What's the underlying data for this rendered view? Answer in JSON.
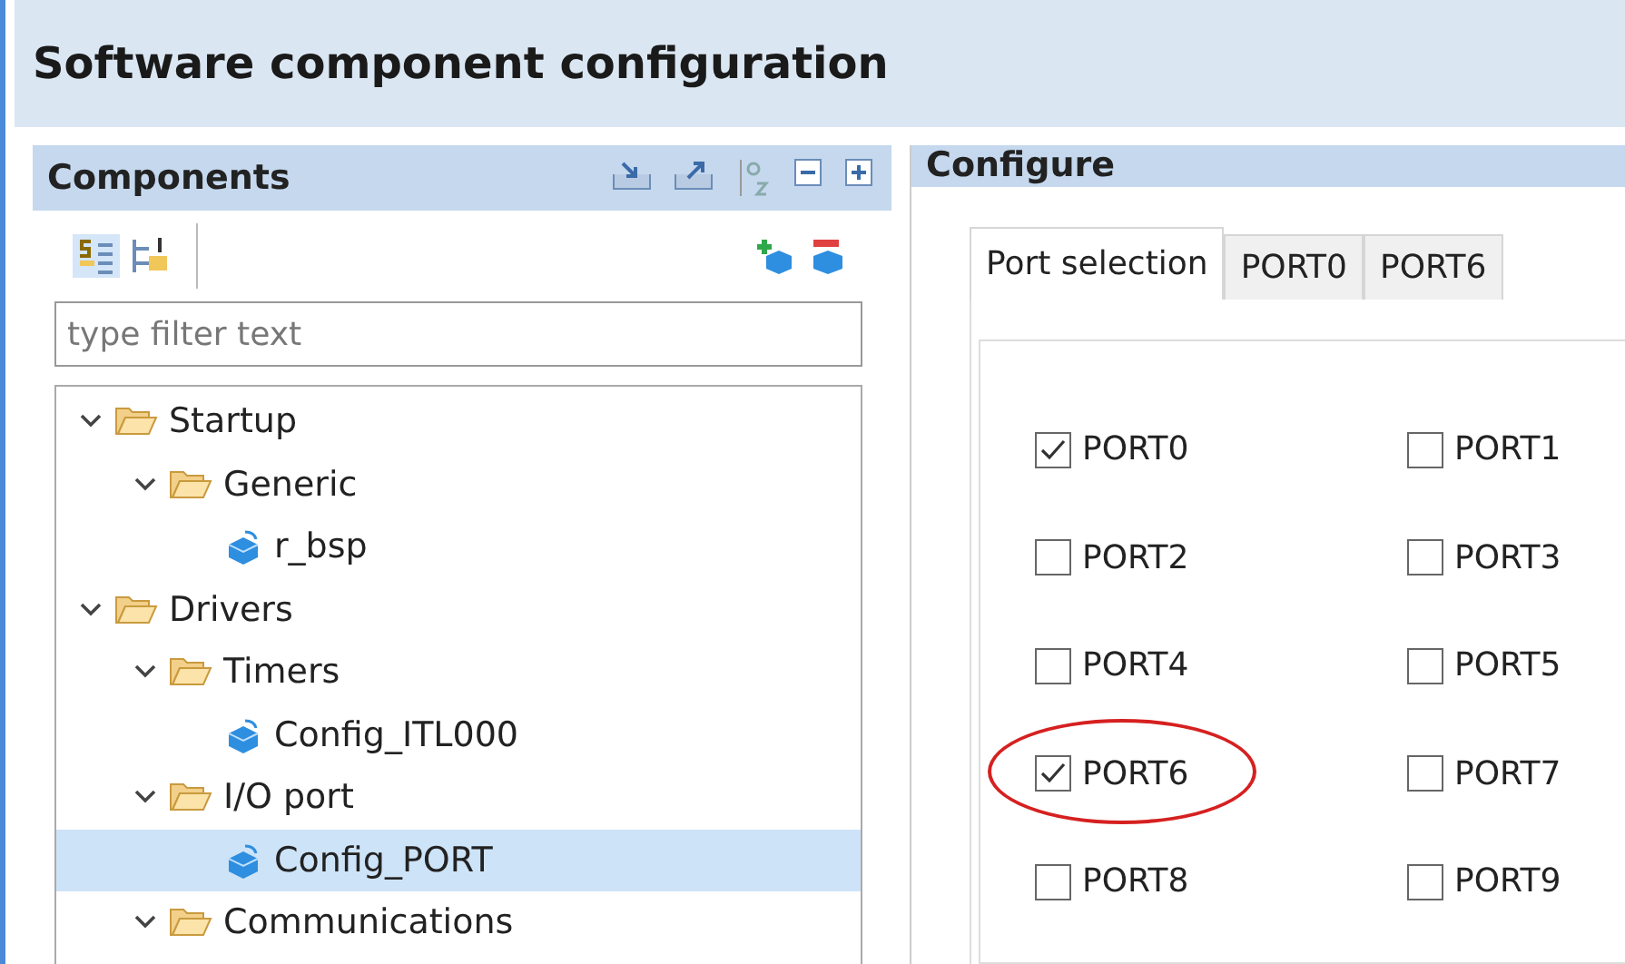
{
  "window": {
    "title": "Software component configuration"
  },
  "components_panel": {
    "title": "Components",
    "filter": {
      "placeholder": "type filter text"
    },
    "tree": [
      {
        "label": "Startup",
        "kind": "folder",
        "expanded": true,
        "selected": false,
        "children": [
          {
            "label": "Generic",
            "kind": "folder",
            "expanded": true,
            "selected": false,
            "children": [
              {
                "label": "r_bsp",
                "kind": "component",
                "selected": false
              }
            ]
          }
        ]
      },
      {
        "label": "Drivers",
        "kind": "folder",
        "expanded": true,
        "selected": false,
        "children": [
          {
            "label": "Timers",
            "kind": "folder",
            "expanded": true,
            "selected": false,
            "children": [
              {
                "label": "Config_ITL000",
                "kind": "component",
                "selected": false
              }
            ]
          },
          {
            "label": "I/O port",
            "kind": "folder",
            "expanded": true,
            "selected": false,
            "children": [
              {
                "label": "Config_PORT",
                "kind": "component",
                "selected": true
              }
            ]
          },
          {
            "label": "Communications",
            "kind": "folder",
            "expanded": true,
            "selected": false
          }
        ]
      }
    ]
  },
  "configure_panel": {
    "title": "Configure",
    "tabs": [
      {
        "label": "Port selection",
        "selected": true
      },
      {
        "label": "PORT0",
        "selected": false
      },
      {
        "label": "PORT6",
        "selected": false
      }
    ],
    "ports": [
      {
        "label": "PORT0",
        "checked": true,
        "highlighted": false
      },
      {
        "label": "PORT1",
        "checked": false,
        "highlighted": false
      },
      {
        "label": "PORT2",
        "checked": false,
        "highlighted": false
      },
      {
        "label": "PORT3",
        "checked": false,
        "highlighted": false
      },
      {
        "label": "PORT4",
        "checked": false,
        "highlighted": false
      },
      {
        "label": "PORT5",
        "checked": false,
        "highlighted": false
      },
      {
        "label": "PORT6",
        "checked": true,
        "highlighted": true
      },
      {
        "label": "PORT7",
        "checked": false,
        "highlighted": false
      },
      {
        "label": "PORT8",
        "checked": false,
        "highlighted": false
      },
      {
        "label": "PORT9",
        "checked": false,
        "highlighted": false
      }
    ]
  }
}
